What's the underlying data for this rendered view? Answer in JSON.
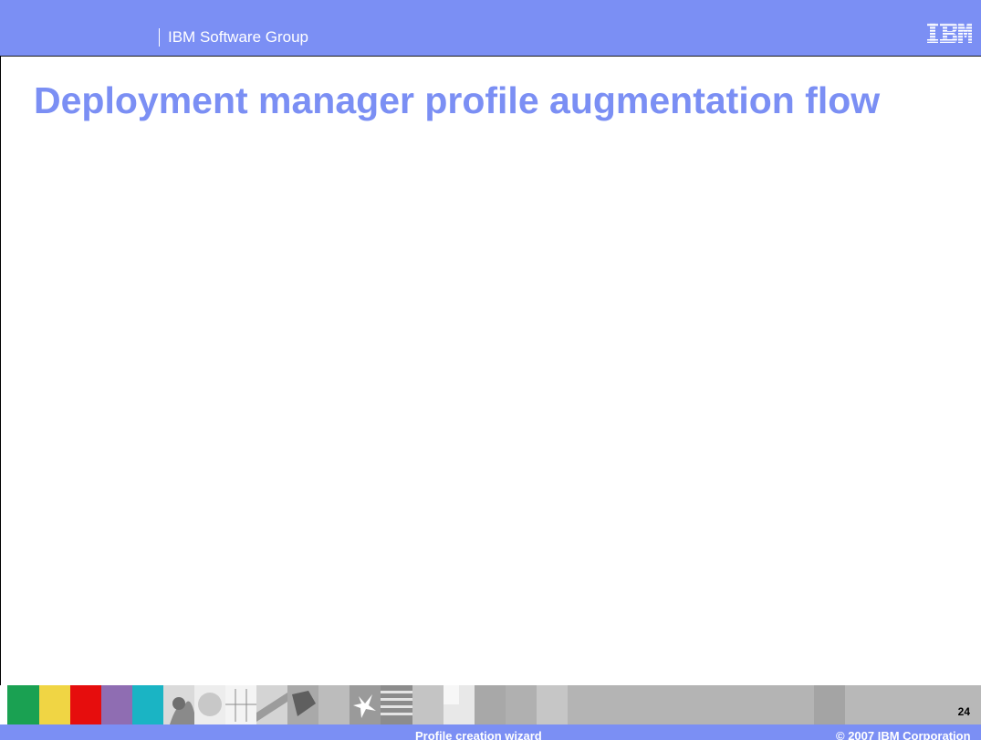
{
  "header": {
    "group_label": "IBM Software Group",
    "logo_text": "IBM",
    "bar_color": "#7b8ff4"
  },
  "slide": {
    "title": "Deployment manager profile augmentation flow",
    "title_color": "#7b8ff4",
    "page_number": "24"
  },
  "footer": {
    "title": "Profile creation wizard",
    "copyright": "© 2007 IBM Corporation",
    "swatch_colors": [
      "#1aa152",
      "#f0d544",
      "#e60d0d",
      "#8f6db2",
      "#1ab4c4"
    ]
  }
}
